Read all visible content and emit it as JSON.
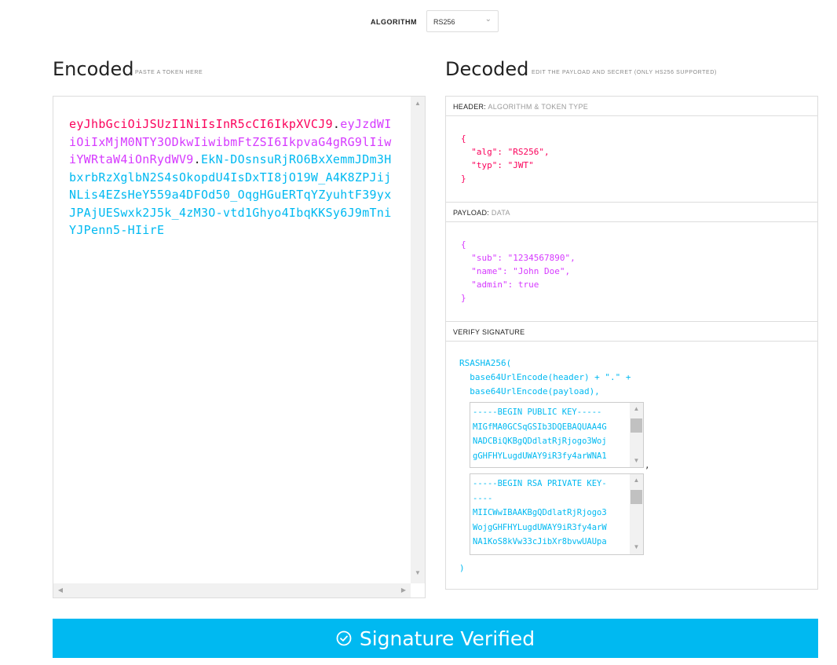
{
  "algorithm": {
    "label": "ALGORITHM",
    "selected": "RS256"
  },
  "encoded": {
    "title": "Encoded",
    "subtitle": "PASTE A TOKEN HERE",
    "token": {
      "header": "eyJhbGciOiJSUzI1NiIsInR5cCI6IkpXVCJ9",
      "payload": "eyJzdWIiOiIxMjM0NTY3ODkwIiwibmFtZSI6IkpvaG4gRG9lIiwiYWRtaW4iOnRydWV9",
      "signature": "EkN-DOsnsuRjRO6BxXemmJDm3HbxrbRzXglbN2S4sOkopdU4IsDxTI8jO19W_A4K8ZPJijNLis4EZsHeY559a4DFOd50_OqgHGuERTqYZyuhtF39yxJPAjUESwxk2J5k_4zM3O-vtd1Ghyo4IbqKKSy6J9mTniYJPenn5-HIirE",
      "dot": "."
    }
  },
  "decoded": {
    "title": "Decoded",
    "subtitle": "EDIT THE PAYLOAD AND SECRET (ONLY HS256 SUPPORTED)",
    "header_section": {
      "label": "HEADER:",
      "sub": "ALGORITHM & TOKEN TYPE",
      "json": "{\n  \"alg\": \"RS256\",\n  \"typ\": \"JWT\"\n}"
    },
    "payload_section": {
      "label": "PAYLOAD:",
      "sub": "DATA",
      "json": "{\n  \"sub\": \"1234567890\",\n  \"name\": \"John Doe\",\n  \"admin\": true\n}"
    },
    "signature_section": {
      "label": "VERIFY SIGNATURE",
      "line1": "RSASHA256(",
      "line2": "  base64UrlEncode(header) + \".\" +",
      "line3": "  base64UrlEncode(payload),",
      "public_key": "-----BEGIN PUBLIC KEY-----\nMIGfMA0GCSqGSIb3DQEBAQUAA4G\nNADCBiQKBgQDdlatRjRjogo3Woj\ngGHFHYLugdUWAY9iR3fy4arWNA1",
      "comma": ",",
      "private_key": "-----BEGIN RSA PRIVATE KEY-\n----\nMIICWwIBAAKBgQDdlatRjRjogo3\nWojgGHFHYLugdUWAY9iR3fy4arW\nNA1KoS8kVw33cJibXr8bvwUAUpa",
      "close": ")"
    }
  },
  "verified": {
    "text": "Signature Verified",
    "icon": "check-circle-icon"
  },
  "colors": {
    "header": "#fb015b",
    "payload": "#d63aff",
    "signature": "#00b9f1",
    "verified_bar": "#00b9f1"
  }
}
